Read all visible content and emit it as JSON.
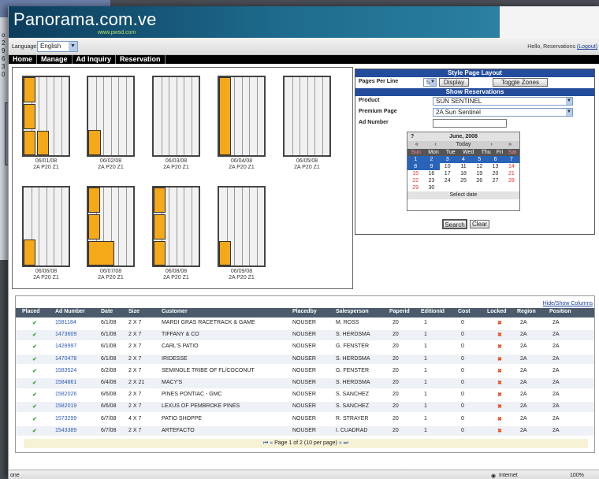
{
  "bg_window": {
    "numbers": [
      "o",
      "2",
      "9",
      "6",
      "3",
      "0"
    ]
  },
  "banner": {
    "title": "Panorama.com.ve",
    "subtitle": "www.pwsd.com"
  },
  "lang": {
    "label": "Language:",
    "value": "English"
  },
  "greeting": {
    "text": "Hello, Reservations",
    "logout": "(Logout)"
  },
  "menu": [
    "Home",
    "Manage",
    "Ad Inquiry",
    "Reservation"
  ],
  "pages": [
    {
      "date": "06/01/08",
      "code": "2A P20 Z1"
    },
    {
      "date": "06/02/08",
      "code": "2A P20 Z1"
    },
    {
      "date": "06/03/08",
      "code": "2A P20 Z1"
    },
    {
      "date": "06/04/08",
      "code": "2A P20 Z1"
    },
    {
      "date": "06/05/08",
      "code": "2A P20 Z1"
    },
    {
      "date": "06/06/08",
      "code": "2A P20 Z1"
    },
    {
      "date": "06/07/08",
      "code": "2A P20 Z1"
    },
    {
      "date": "06/08/08",
      "code": "2A P20 Z1"
    },
    {
      "date": "06/09/08",
      "code": "2A P20 Z1"
    }
  ],
  "layout": {
    "style_heading": "Style Page Layout",
    "pages_per_line_label": "Pages Per Line",
    "pages_per_line_value": "5",
    "display_btn": "Display",
    "toggle_btn": "Toggle Zones",
    "show_heading": "Show Reservations",
    "product_label": "Product",
    "product_value": "SUN SENTINEL",
    "premium_label": "Premium Page",
    "premium_value": "2A Sun Sentinel",
    "adnum_label": "Ad Number",
    "search_btn": "Search",
    "clear_btn": "Clear"
  },
  "calendar": {
    "title": "June, 2008",
    "help": "?",
    "nav": [
      "«",
      "‹",
      "Today",
      "›",
      "»"
    ],
    "days": [
      "Sun",
      "Mon",
      "Tue",
      "Wed",
      "Thu",
      "Fri",
      "Sat"
    ],
    "weeks": [
      [
        "1",
        "2",
        "3",
        "4",
        "5",
        "6",
        "7"
      ],
      [
        "8",
        "9",
        "10",
        "11",
        "12",
        "13",
        "14"
      ],
      [
        "15",
        "16",
        "17",
        "18",
        "19",
        "20",
        "21"
      ],
      [
        "22",
        "23",
        "24",
        "25",
        "26",
        "27",
        "28"
      ],
      [
        "29",
        "30",
        "",
        "",
        "",
        "",
        ""
      ]
    ],
    "footer": "Select date"
  },
  "grid": {
    "hide_show": "Hide/Show Columns",
    "columns": [
      "Placed",
      "Ad Number",
      "Date",
      "Size",
      "Customer",
      "Placedby",
      "Salesperson",
      "Paperid",
      "Editionid",
      "Cost",
      "Locked",
      "Region",
      "Position"
    ],
    "rows": [
      [
        "1581184",
        "6/1/08",
        "2 X 7",
        "MARDI GRAS RACETRACK & GAME",
        "NOUSER",
        "M. ROSS",
        "20",
        "1",
        "0",
        "2A",
        "2A"
      ],
      [
        "1473609",
        "6/1/08",
        "2 X 7",
        "TIFFANY & CO",
        "NOUSER",
        "S. HERDSMA",
        "20",
        "1",
        "0",
        "2A",
        "2A"
      ],
      [
        "1428997",
        "6/1/08",
        "2 X 7",
        "CARL'S PATIO",
        "NOUSER",
        "G. FENSTER",
        "20",
        "1",
        "0",
        "2A",
        "2A"
      ],
      [
        "1470478",
        "6/1/08",
        "2 X 7",
        "IRIDESSE",
        "NOUSER",
        "S. HERDSMA",
        "20",
        "1",
        "0",
        "2A",
        "2A"
      ],
      [
        "1583524",
        "6/2/08",
        "2 X 7",
        "SEMINOLE TRIBE OF FL/COCONUT",
        "NOUSER",
        "G. FENSTER",
        "20",
        "1",
        "0",
        "2A",
        "2A"
      ],
      [
        "1584861",
        "6/4/08",
        "2 X 21",
        "MACY'S",
        "NOUSER",
        "S. HERDSMA",
        "20",
        "1",
        "0",
        "2A",
        "2A"
      ],
      [
        "1582026",
        "6/6/08",
        "2 X 7",
        "PINES PONTIAC - GMC",
        "NOUSER",
        "S. SANCHEZ",
        "20",
        "1",
        "0",
        "2A",
        "2A"
      ],
      [
        "1582019",
        "6/6/08",
        "2 X 7",
        "LEXUS OF PEMBROKE PINES",
        "NOUSER",
        "S. SANCHEZ",
        "20",
        "1",
        "0",
        "2A",
        "2A"
      ],
      [
        "1573299",
        "6/7/08",
        "4 X 7",
        "PATIO SHOPPE",
        "NOUSER",
        "R. STRAYER",
        "20",
        "1",
        "0",
        "2A",
        "2A"
      ],
      [
        "1543389",
        "6/7/08",
        "2 X 7",
        "ARTEFACTO",
        "NOUSER",
        "I. CUADRAD",
        "20",
        "1",
        "0",
        "2A",
        "2A"
      ]
    ],
    "pager": "Page 1 of 2 (10 per page)",
    "pager_first": "⏮",
    "pager_prev": "«",
    "pager_next": "»",
    "pager_last": "⏭"
  },
  "status": {
    "left": "one",
    "zone": "Internet",
    "zoom": "100%"
  },
  "colors": {
    "ad_fill": "#f5a818",
    "header_blue": "#234c9c",
    "banner_dark": "#0d3d5c"
  }
}
